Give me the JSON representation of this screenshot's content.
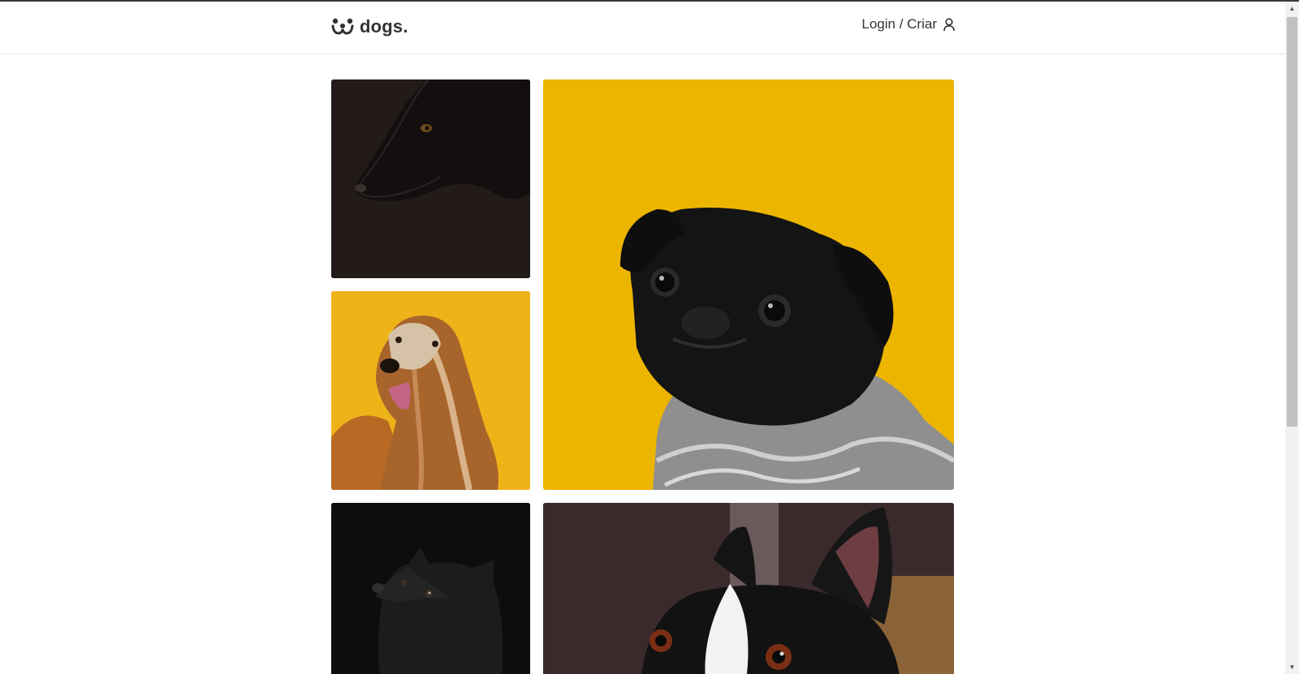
{
  "header": {
    "logo_text": "dogs.",
    "login_label": "Login / Criar"
  },
  "feed": {
    "photos": [
      {
        "subject": "black shepherd dog on dark background",
        "bg": "#231a1a"
      },
      {
        "subject": "black pug in knit sweater on yellow background",
        "bg": "#ecb500"
      },
      {
        "subject": "afghan hound on yellow background",
        "bg": "#efb31a"
      },
      {
        "subject": "small black dog looking up on black background",
        "bg": "#0d0d0d"
      },
      {
        "subject": "boston terrier close-up",
        "bg": "#3a2a2c"
      }
    ]
  },
  "icons": {
    "logo": "dog-face-icon",
    "user": "user-icon"
  },
  "colors": {
    "accent_yellow": "#fb1",
    "text": "#333333",
    "border": "#e8e8e8"
  }
}
